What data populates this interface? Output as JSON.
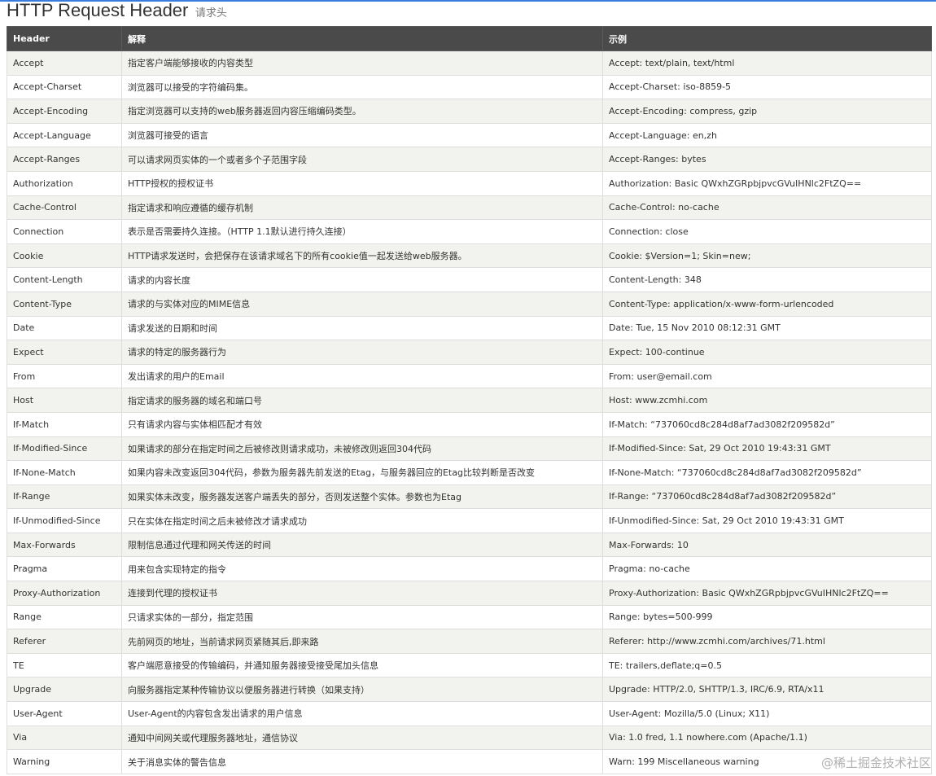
{
  "title": {
    "main": "HTTP Request Header",
    "sub": "请求头"
  },
  "colors": {
    "header_bg": "#4a4a4a",
    "row_alt_bg": "#f2f2ee",
    "accent": "#3b7ddd"
  },
  "table": {
    "columns": [
      "Header",
      "解释",
      "示例"
    ],
    "rows": [
      [
        "Accept",
        "指定客户端能够接收的内容类型",
        "Accept: text/plain, text/html"
      ],
      [
        "Accept-Charset",
        "浏览器可以接受的字符编码集。",
        "Accept-Charset: iso-8859-5"
      ],
      [
        "Accept-Encoding",
        "指定浏览器可以支持的web服务器返回内容压缩编码类型。",
        "Accept-Encoding: compress, gzip"
      ],
      [
        "Accept-Language",
        "浏览器可接受的语言",
        "Accept-Language: en,zh"
      ],
      [
        "Accept-Ranges",
        "可以请求网页实体的一个或者多个子范围字段",
        "Accept-Ranges: bytes"
      ],
      [
        "Authorization",
        "HTTP授权的授权证书",
        "Authorization: Basic QWxhZGRpbjpvcGVuIHNlc2FtZQ=="
      ],
      [
        "Cache-Control",
        "指定请求和响应遵循的缓存机制",
        "Cache-Control: no-cache"
      ],
      [
        "Connection",
        "表示是否需要持久连接。（HTTP 1.1默认进行持久连接）",
        "Connection: close"
      ],
      [
        "Cookie",
        "HTTP请求发送时，会把保存在该请求域名下的所有cookie值一起发送给web服务器。",
        "Cookie: $Version=1; Skin=new;"
      ],
      [
        "Content-Length",
        "请求的内容长度",
        "Content-Length: 348"
      ],
      [
        "Content-Type",
        "请求的与实体对应的MIME信息",
        "Content-Type: application/x-www-form-urlencoded"
      ],
      [
        "Date",
        "请求发送的日期和时间",
        "Date: Tue, 15 Nov 2010 08:12:31 GMT"
      ],
      [
        "Expect",
        "请求的特定的服务器行为",
        "Expect: 100-continue"
      ],
      [
        "From",
        "发出请求的用户的Email",
        "From: user@email.com"
      ],
      [
        "Host",
        "指定请求的服务器的域名和端口号",
        "Host: www.zcmhi.com"
      ],
      [
        "If-Match",
        "只有请求内容与实体相匹配才有效",
        "If-Match: “737060cd8c284d8af7ad3082f209582d”"
      ],
      [
        "If-Modified-Since",
        "如果请求的部分在指定时间之后被修改则请求成功，未被修改则返回304代码",
        "If-Modified-Since: Sat, 29 Oct 2010 19:43:31 GMT"
      ],
      [
        "If-None-Match",
        "如果内容未改变返回304代码，参数为服务器先前发送的Etag，与服务器回应的Etag比较判断是否改变",
        "If-None-Match: “737060cd8c284d8af7ad3082f209582d”"
      ],
      [
        "If-Range",
        "如果实体未改变，服务器发送客户端丢失的部分，否则发送整个实体。参数也为Etag",
        "If-Range: “737060cd8c284d8af7ad3082f209582d”"
      ],
      [
        "If-Unmodified-Since",
        "只在实体在指定时间之后未被修改才请求成功",
        "If-Unmodified-Since: Sat, 29 Oct 2010 19:43:31 GMT"
      ],
      [
        "Max-Forwards",
        "限制信息通过代理和网关传送的时间",
        "Max-Forwards: 10"
      ],
      [
        "Pragma",
        "用来包含实现特定的指令",
        "Pragma: no-cache"
      ],
      [
        "Proxy-Authorization",
        "连接到代理的授权证书",
        "Proxy-Authorization: Basic QWxhZGRpbjpvcGVuIHNlc2FtZQ=="
      ],
      [
        "Range",
        "只请求实体的一部分，指定范围",
        "Range: bytes=500-999"
      ],
      [
        "Referer",
        "先前网页的地址，当前请求网页紧随其后,即来路",
        "Referer: http://www.zcmhi.com/archives/71.html"
      ],
      [
        "TE",
        "客户端愿意接受的传输编码，并通知服务器接受接受尾加头信息",
        "TE: trailers,deflate;q=0.5"
      ],
      [
        "Upgrade",
        "向服务器指定某种传输协议以便服务器进行转换（如果支持）",
        "Upgrade: HTTP/2.0, SHTTP/1.3, IRC/6.9, RTA/x11"
      ],
      [
        "User-Agent",
        "User-Agent的内容包含发出请求的用户信息",
        "User-Agent: Mozilla/5.0 (Linux; X11)"
      ],
      [
        "Via",
        "通知中间网关或代理服务器地址，通信协议",
        "Via: 1.0 fred, 1.1 nowhere.com (Apache/1.1)"
      ],
      [
        "Warning",
        "关于消息实体的警告信息",
        "Warn: 199 Miscellaneous warning"
      ]
    ]
  },
  "watermark": "@稀土掘金技术社区"
}
